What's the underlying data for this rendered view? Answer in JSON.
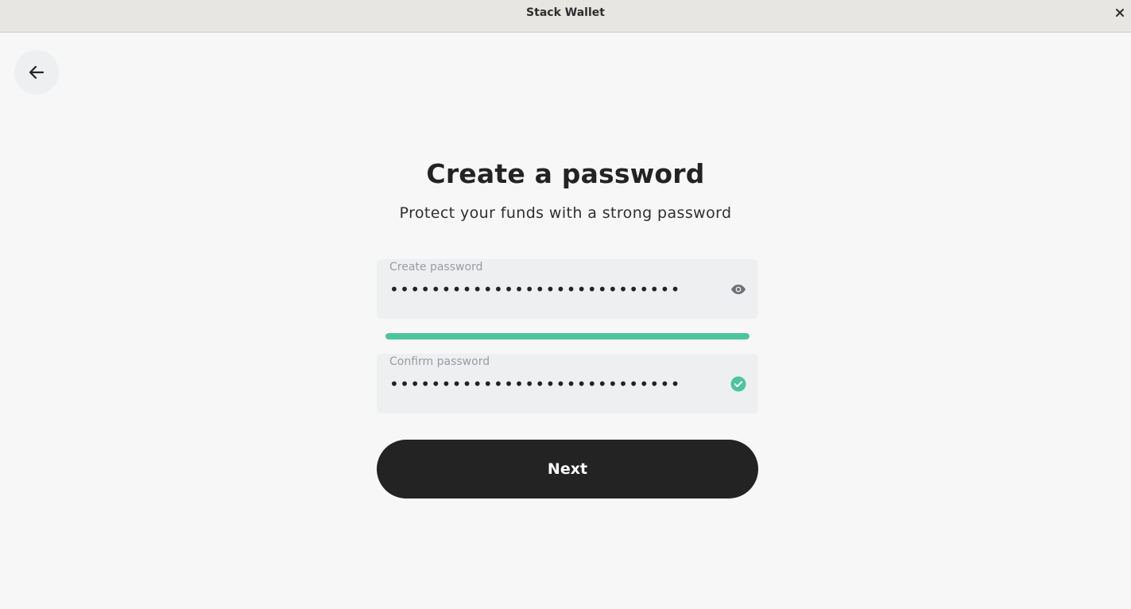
{
  "window": {
    "title": "Stack Wallet",
    "close_icon": "close-icon"
  },
  "header": {
    "back_icon": "arrow-left-icon"
  },
  "main": {
    "title": "Create a password",
    "subtitle": "Protect your funds with a strong password",
    "create_password": {
      "label": "Create password",
      "value": "••••••••••••••••••••••••••••",
      "suffix_icon": "eye-icon"
    },
    "strength": {
      "level": 1.0,
      "color": "#4cc59b"
    },
    "confirm_password": {
      "label": "Confirm password",
      "value": "••••••••••••••••••••••••••••",
      "suffix_icon": "check-circle-icon",
      "suffix_color": "#4cc59b"
    },
    "next_label": "Next"
  },
  "colors": {
    "background": "#f7f7f7",
    "field_background": "#eeeff1",
    "primary_button": "#232323",
    "accent": "#4cc59b"
  }
}
